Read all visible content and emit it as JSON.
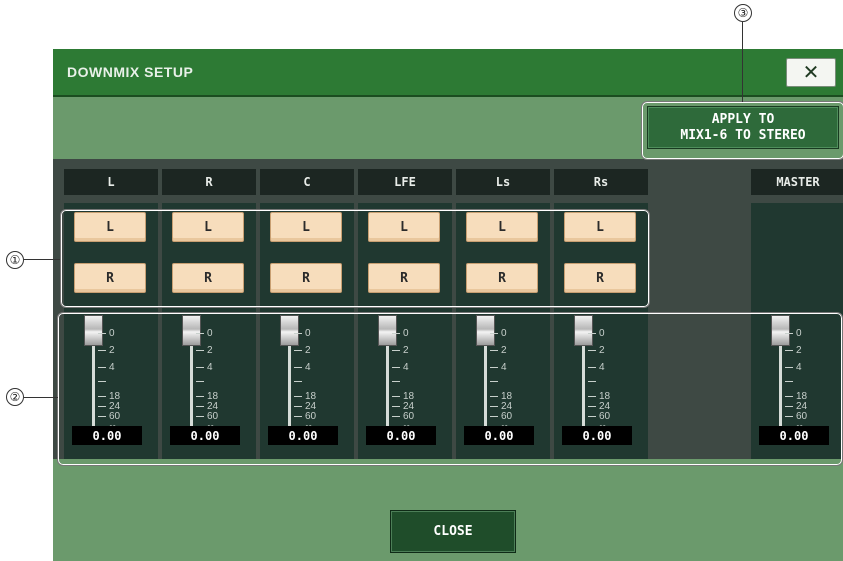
{
  "window": {
    "title": "DOWNMIX SETUP",
    "close_glyph": "✕"
  },
  "apply_button": {
    "line1": "APPLY TO",
    "line2": "MIX1-6 TO STEREO"
  },
  "channels": [
    {
      "name": "L",
      "left_label": "L",
      "right_label": "R",
      "value": "0.00"
    },
    {
      "name": "R",
      "left_label": "L",
      "right_label": "R",
      "value": "0.00"
    },
    {
      "name": "C",
      "left_label": "L",
      "right_label": "R",
      "value": "0.00"
    },
    {
      "name": "LFE",
      "left_label": "L",
      "right_label": "R",
      "value": "0.00"
    },
    {
      "name": "Ls",
      "left_label": "L",
      "right_label": "R",
      "value": "0.00"
    },
    {
      "name": "Rs",
      "left_label": "L",
      "right_label": "R",
      "value": "0.00"
    }
  ],
  "master": {
    "name": "MASTER",
    "value": "0.00"
  },
  "fader_scale": [
    "0",
    "2",
    "4",
    "",
    "18",
    "24",
    "60",
    "∞"
  ],
  "close_button": {
    "label": "CLOSE"
  },
  "callouts": [
    "①",
    "②",
    "③"
  ],
  "colors": {
    "title_bar": "#2d7a34",
    "panel": "#3e4944",
    "assign_button": "#f7ddbc",
    "window_bg": "#6b9a6c"
  }
}
